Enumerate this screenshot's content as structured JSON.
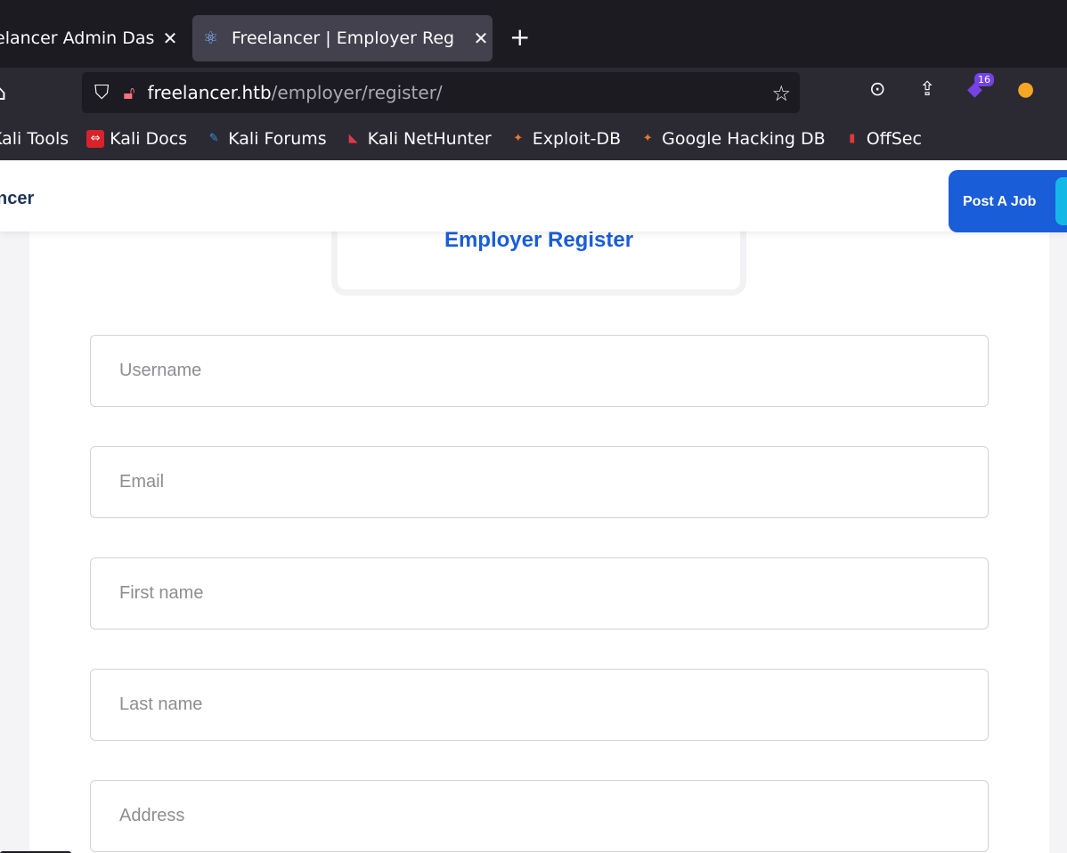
{
  "browser": {
    "tabs": [
      {
        "title": "elancer Admin Das",
        "active": false
      },
      {
        "title": "Freelancer | Employer Reg",
        "active": true
      }
    ],
    "new_tab_label": "+",
    "url_host": "freelancer.htb",
    "url_path": "/employer/register/",
    "extension_badge": "16",
    "bookmarks": [
      {
        "label": "Kali Tools",
        "icon": "kali-icon"
      },
      {
        "label": "Kali Docs",
        "icon": "kali-docs-icon"
      },
      {
        "label": "Kali Forums",
        "icon": "kali-forums-icon"
      },
      {
        "label": "Kali NetHunter",
        "icon": "nethunter-icon"
      },
      {
        "label": "Exploit-DB",
        "icon": "exploit-db-icon"
      },
      {
        "label": "Google Hacking DB",
        "icon": "ghdb-icon"
      },
      {
        "label": "OffSec",
        "icon": "offsec-icon"
      }
    ]
  },
  "site": {
    "logo_text": "ncer",
    "post_job_label": "Post A Job",
    "form_title": "Employer Register",
    "fields": [
      {
        "name": "username",
        "placeholder": "Username"
      },
      {
        "name": "email",
        "placeholder": "Email"
      },
      {
        "name": "first_name",
        "placeholder": "First name"
      },
      {
        "name": "last_name",
        "placeholder": "Last name"
      },
      {
        "name": "address",
        "placeholder": "Address"
      }
    ]
  },
  "colors": {
    "accent": "#1a5dd8",
    "chrome_bg": "#1c1b22",
    "toolbar_bg": "#2b2a33"
  }
}
